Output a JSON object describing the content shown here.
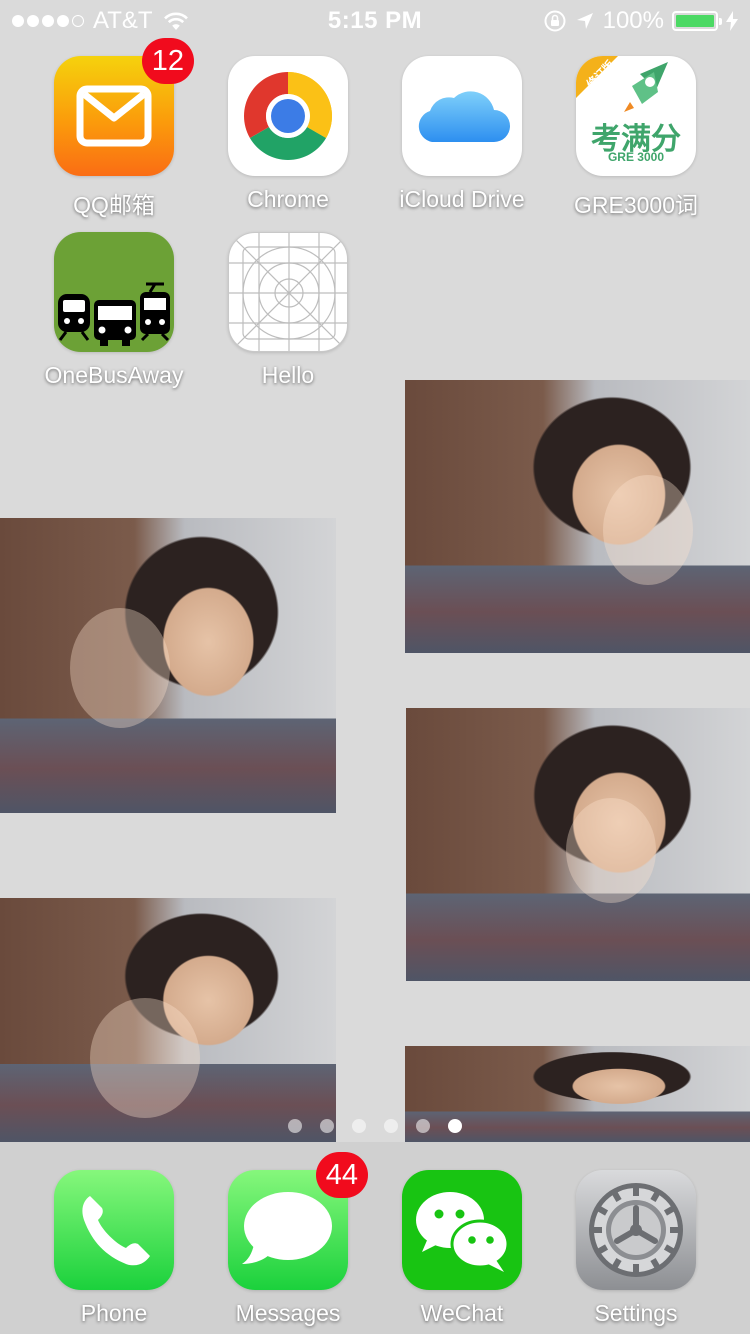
{
  "status_bar": {
    "carrier": "AT&T",
    "time": "5:15 PM",
    "battery_percent": "100%",
    "battery_level": 1.0,
    "signal_bars_filled": 4,
    "signal_bars_total": 5
  },
  "apps": [
    {
      "label": "QQ邮箱",
      "badge": "12",
      "icon": "mail-icon"
    },
    {
      "label": "Chrome",
      "icon": "chrome-icon"
    },
    {
      "label": "iCloud Drive",
      "icon": "cloud-icon"
    },
    {
      "label": "GRE3000词",
      "icon": "gre-app-icon"
    },
    {
      "label": "OneBusAway",
      "icon": "transit-icon"
    },
    {
      "label": "Hello",
      "icon": "icon-grid-template"
    }
  ],
  "dock": [
    {
      "label": "Phone",
      "icon": "phone-icon"
    },
    {
      "label": "Messages",
      "badge": "44",
      "icon": "speech-bubble-icon"
    },
    {
      "label": "WeChat",
      "icon": "wechat-icon"
    },
    {
      "label": "Settings",
      "icon": "gear-icon"
    }
  ],
  "gre_icon": {
    "ribbon": "修订版",
    "title": "考满分",
    "subtitle": "GRE 3000"
  },
  "page_indicator": {
    "count": 6,
    "active": 6
  }
}
